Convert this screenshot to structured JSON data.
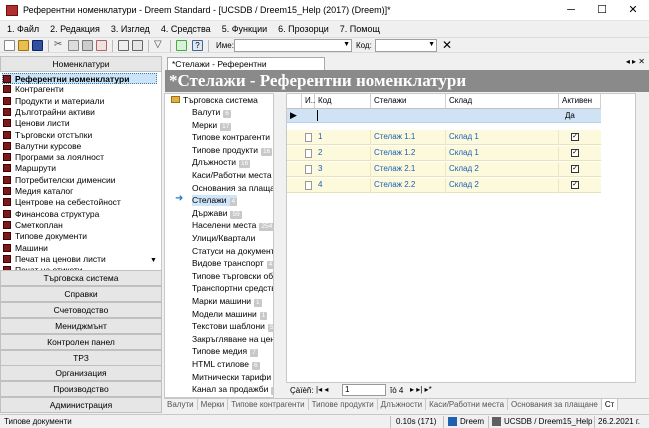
{
  "window": {
    "title": "Референтни номенклатури - Dreem Standard - [UCSDB / Dreem15_Help (2017) (Dreem)]*"
  },
  "menu": [
    "1. Файл",
    "2. Редакция",
    "3. Изглед",
    "4. Средства",
    "5. Функции",
    "6. Прозорци",
    "7. Помощ"
  ],
  "toolbar": {
    "name_label": "Име:",
    "code_label": "Код:"
  },
  "nav": {
    "header": "Номенклатури",
    "items": [
      "Референтни номенклатури",
      "Контрагенти",
      "Продукти и материали",
      "Дълготрайни активи",
      "Ценови листи",
      "Търговски отстъпки",
      "Валутни курсове",
      "Програми за лоялност",
      "Маршрути",
      "Потребителски дименсии",
      "Медия каталог",
      "Центрове на себестойност",
      "Финансова структура",
      "Сметкоплан",
      "Типове документи",
      "Машини",
      "Печат на ценови листи",
      "Печат на етикети"
    ],
    "sections": [
      "Търговска система",
      "Справки",
      "Счетоводство",
      "Мениджмънт",
      "Контролен панел",
      "ТРЗ",
      "Организация",
      "Производство",
      "Администрация"
    ]
  },
  "tab": {
    "label": "*Стелажи - Референтни номенклатури"
  },
  "banner": "*Стелажи - Референтни номенклатури",
  "tree": {
    "root": "Търговска система",
    "nodes": [
      {
        "label": "Валути",
        "count": "6"
      },
      {
        "label": "Мерки",
        "count": "17"
      },
      {
        "label": "Типове контрагенти",
        "count": "5"
      },
      {
        "label": "Типове продукти",
        "count": "16"
      },
      {
        "label": "Длъжности",
        "count": "16"
      },
      {
        "label": "Каси/Работни места",
        "count": "1"
      },
      {
        "label": "Основания за плащане",
        "count": ""
      },
      {
        "label": "Стелажи",
        "count": "4"
      },
      {
        "label": "Държави",
        "count": "59"
      },
      {
        "label": "Населени места",
        "count": "254"
      },
      {
        "label": "Улици/Квартали",
        "count": ""
      },
      {
        "label": "Статуси на документи",
        "count": ""
      },
      {
        "label": "Видове транспорт",
        "count": "4"
      },
      {
        "label": "Типове търговски обекти",
        "count": ""
      },
      {
        "label": "Транспортни средства",
        "count": ""
      },
      {
        "label": "Марки машини",
        "count": "1"
      },
      {
        "label": "Модели машини",
        "count": "1"
      },
      {
        "label": "Текстови шаблони",
        "count": "5"
      },
      {
        "label": "Закръгляване на цени",
        "count": ""
      },
      {
        "label": "Типове медия",
        "count": "7"
      },
      {
        "label": "HTML стилове",
        "count": "6"
      },
      {
        "label": "Митнически тарифи",
        "count": "1"
      },
      {
        "label": "Канал за продажби",
        "count": "4"
      },
      {
        "label": "Търговски обекти",
        "count": ""
      }
    ]
  },
  "grid": {
    "headers": [
      "И...",
      "Код",
      "Стелажи",
      "Склад",
      "Активен"
    ],
    "new_row_active": "Да",
    "rows": [
      {
        "code": "1",
        "name": "Стелаж 1.1",
        "store": "Склад 1",
        "active": true
      },
      {
        "code": "2",
        "name": "Стелаж 1.2",
        "store": "Склад 1",
        "active": true
      },
      {
        "code": "3",
        "name": "Стелаж 2.1",
        "store": "Склад 2",
        "active": true
      },
      {
        "code": "4",
        "name": "Стелаж 2.2",
        "store": "Склад 2",
        "active": true
      }
    ]
  },
  "pager": {
    "label": "Çàïèñ:",
    "page": "1",
    "of": "îò 4"
  },
  "bottom_tabs": [
    "Валути",
    "Мерки",
    "Типове контрагенти",
    "Типове продукти",
    "Длъжности",
    "Каси/Работни места",
    "Основания за плащане",
    "Ст"
  ],
  "status": {
    "left": "Типове документи",
    "time": "0.10s (171)",
    "user": "Dreem",
    "db": "UCSDB / Dreem15_Help",
    "date": "26.2.2021 г."
  }
}
